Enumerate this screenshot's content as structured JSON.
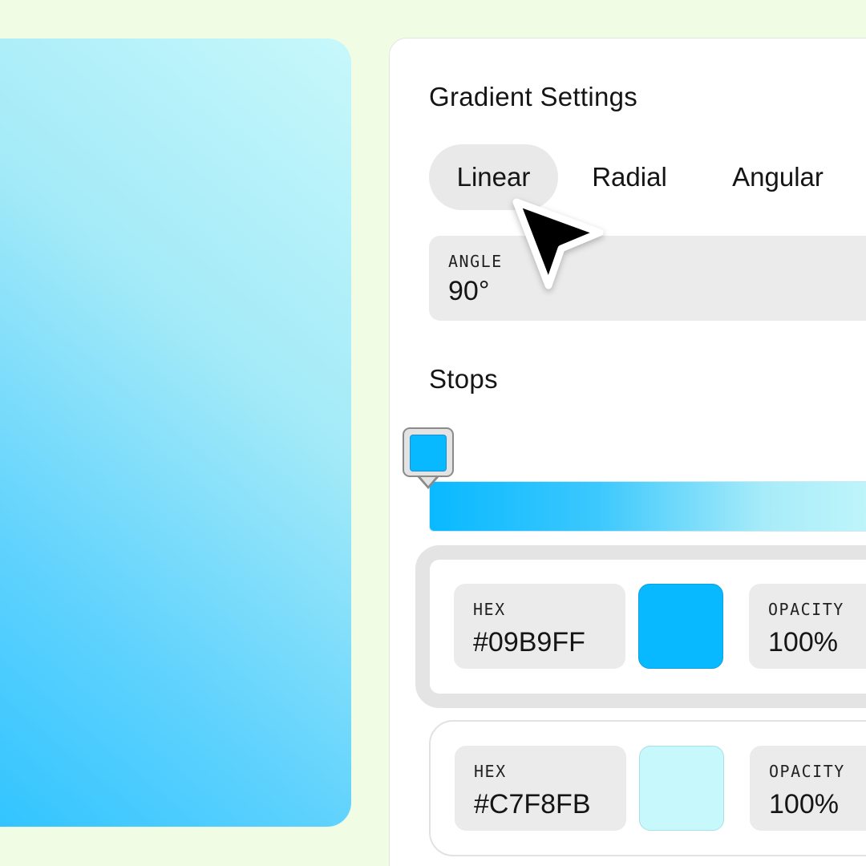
{
  "gradient_settings": {
    "title": "Gradient Settings",
    "tabs": [
      {
        "label": "Linear",
        "active": true
      },
      {
        "label": "Radial",
        "active": false
      },
      {
        "label": "Angular",
        "active": false
      }
    ],
    "angle": {
      "label": "ANGLE",
      "value": "90°"
    }
  },
  "stops": {
    "title": "Stops",
    "items": [
      {
        "hex_label": "HEX",
        "hex_value": "#09B9FF",
        "color": "#09B9FF",
        "opacity_label": "OPACITY",
        "opacity_value": "100%",
        "selected": true
      },
      {
        "hex_label": "HEX",
        "hex_value": "#C7F8FB",
        "color": "#C7F8FB",
        "opacity_label": "OPACITY",
        "opacity_value": "100%",
        "selected": false
      }
    ]
  },
  "colors": {
    "page_bg": "#F0FDE4",
    "gradient_start": "#09B9FF",
    "gradient_end": "#C7F8FB"
  }
}
